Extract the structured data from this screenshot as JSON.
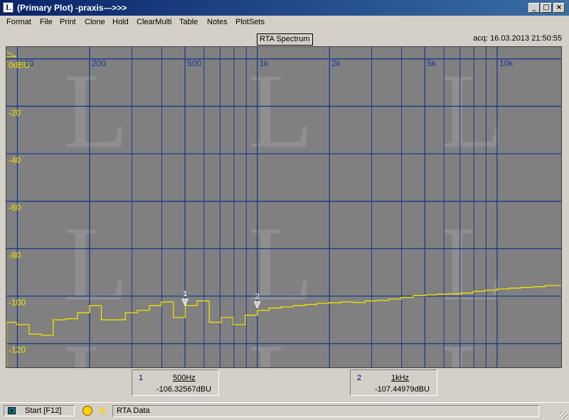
{
  "window": {
    "title": "(Primary Plot) -praxis--->>>",
    "buttons": [
      "_",
      "□",
      "×"
    ]
  },
  "menu": [
    "Format",
    "File",
    "Print",
    "Clone",
    "Hold",
    "ClearMulti",
    "Table",
    "Notes",
    "PlotSets"
  ],
  "plot": {
    "title": "RTA Spectrum",
    "acquired": "acq: 16.03.2013 21:50:55",
    "colors": {
      "background": "#808080",
      "grid": "#1a3a8c",
      "trace": "#f0e000",
      "freq_labels": "#1a3a8c",
      "level_labels": "#f0e000",
      "watermark": "#9a9a9a"
    }
  },
  "chart_data": {
    "type": "line",
    "x_scale": "log",
    "xlim": [
      90,
      18500
    ],
    "ylim": [
      -130,
      5
    ],
    "x_ticks": [
      {
        "value": 100,
        "label": "100"
      },
      {
        "value": 200,
        "label": "200"
      },
      {
        "value": 500,
        "label": "500"
      },
      {
        "value": 1000,
        "label": "1k"
      },
      {
        "value": 2000,
        "label": "2k"
      },
      {
        "value": 5000,
        "label": "5k"
      },
      {
        "value": 10000,
        "label": "10k"
      }
    ],
    "x_minor_ticks": [
      300,
      400,
      600,
      700,
      800,
      900,
      3000,
      4000,
      6000,
      7000,
      8000,
      9000
    ],
    "y_ticks": [
      {
        "value": 0,
        "label": "0dBU"
      },
      {
        "value": -20,
        "label": "-20"
      },
      {
        "value": -40,
        "label": "-40"
      },
      {
        "value": -60,
        "label": "-60"
      },
      {
        "value": -80,
        "label": "-80"
      },
      {
        "value": -100,
        "label": "-100"
      },
      {
        "value": -120,
        "label": "-120"
      }
    ],
    "grid": true,
    "series": [
      {
        "style": "step",
        "x": [
          90,
          99,
          112,
          126,
          141,
          159,
          178,
          200,
          224,
          251,
          282,
          316,
          355,
          398,
          447,
          501,
          562,
          631,
          708,
          794,
          891,
          1000,
          1122,
          1259,
          1413,
          1585,
          1778,
          1995,
          2239,
          2512,
          2818,
          3162,
          3548,
          3981,
          4467,
          5012,
          5623,
          6310,
          7079,
          7943,
          8913,
          10000,
          11220,
          12589,
          14125,
          15849,
          17783
        ],
        "y": [
          -111,
          -112,
          -116,
          -116.5,
          -110,
          -109.5,
          -107,
          -104,
          -110,
          -110,
          -107,
          -106,
          -104,
          -102.5,
          -109,
          -104,
          -102,
          -111,
          -109,
          -112,
          -108,
          -106,
          -105,
          -104.5,
          -104,
          -103.5,
          -103,
          -102.8,
          -102.4,
          -102.7,
          -102,
          -101.8,
          -101.2,
          -100.5,
          -99.8,
          -99.5,
          -99.2,
          -99,
          -98.7,
          -98,
          -97.5,
          -97,
          -96.6,
          -96.3,
          -96,
          -95.6,
          -95.5
        ]
      }
    ],
    "markers": [
      {
        "label": "1",
        "x": 500,
        "y": -106.32567
      },
      {
        "label": "2",
        "x": 1000,
        "y": -107.44979
      }
    ]
  },
  "cursors": [
    {
      "num": "1",
      "freq": "500Hz",
      "value": "-106.32567dBU"
    },
    {
      "num": "2",
      "freq": "1kHz",
      "value": "-107.44979dBU"
    }
  ],
  "statusbar": {
    "start_label": "Start [F12]",
    "status_text": "RTA Data"
  },
  "icons": {
    "app": "lab-logo-icon",
    "start": "start-icon",
    "gauge": "gauge-icon",
    "plug": "plug-icon"
  }
}
